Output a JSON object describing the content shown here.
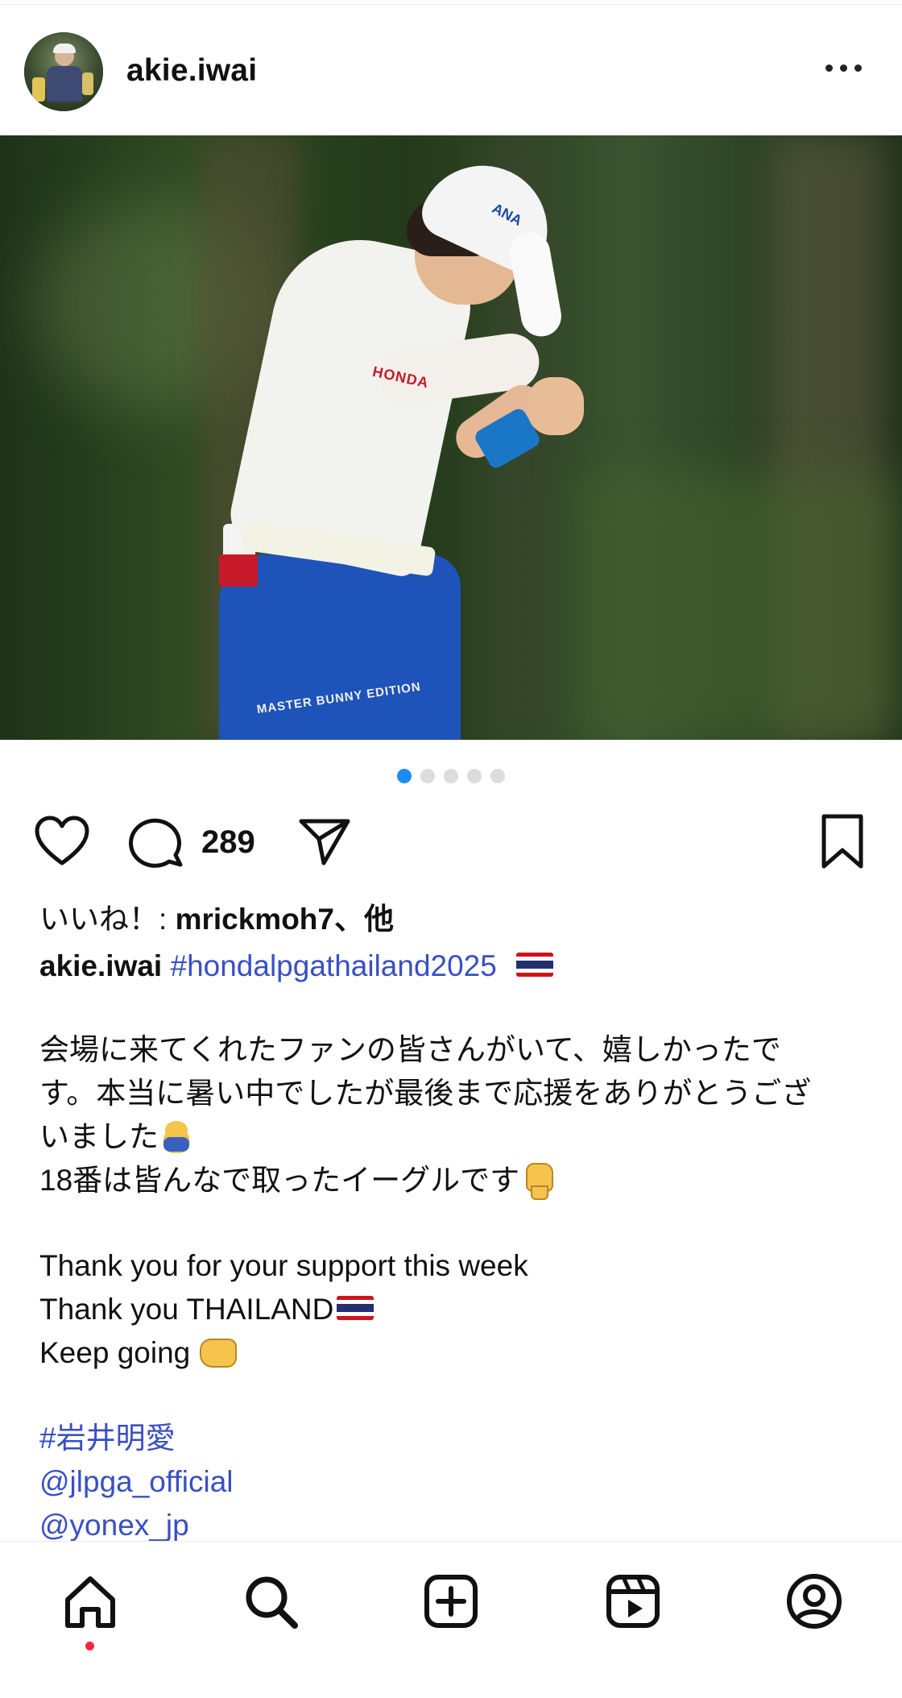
{
  "post": {
    "username": "akie.iwai"
  },
  "carousel": {
    "total": 5,
    "active_index": 0
  },
  "actions": {
    "comment_count": "289"
  },
  "likes": {
    "prefix": "いいね！: ",
    "user": "mrickmoh7、他"
  },
  "caption": {
    "user": "akie.iwai",
    "hashtag_header": "#hondalpgathailand2025",
    "jp_line1": "会場に来てくれたファンの皆さんがいて、嬉しかったで",
    "jp_line2": "す。本当に暑い中でしたが最後まで応援をありがとうござ",
    "jp_line3": "いました",
    "jp_line4": "18番は皆んなで取ったイーグルです",
    "en_line1": "Thank you for your support this week",
    "en_line2": "Thank you THAILAND",
    "en_line3": "Keep going",
    "tag_jp": "#岩井明愛",
    "mention1": "@jlpga_official",
    "mention2": "@yonex_jp"
  },
  "photo": {
    "shirt_brand": "HONDA",
    "cap_brand": "ANA",
    "pants_text": "MASTER BUNNY EDITION"
  },
  "colors": {
    "link": "#3a4fc4",
    "active_dot": "#1d8cf8",
    "notification_dot": "#ff2442"
  },
  "icons": {
    "like": "heart-icon",
    "comment": "comment-icon",
    "share": "share-icon",
    "save": "bookmark-icon",
    "more": "more-options-icon",
    "nav": [
      "home-icon",
      "search-icon",
      "create-icon",
      "reels-icon",
      "profile-icon"
    ]
  }
}
